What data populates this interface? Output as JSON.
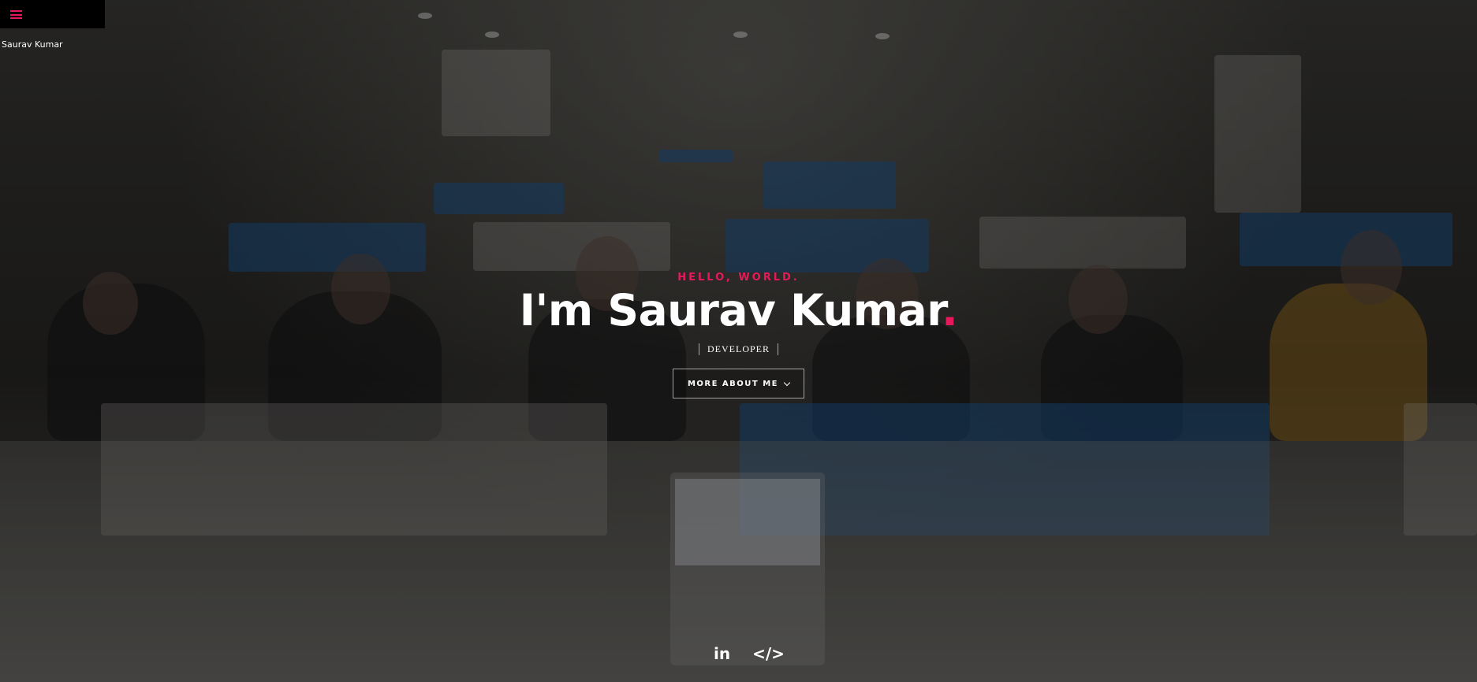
{
  "menu": {
    "hamburger_icon": "hamburger-menu-icon",
    "site_name": "Saurav Kumar"
  },
  "hero": {
    "greeting": "HELLO, WORLD.",
    "name": "I'm Saurav Kumar",
    "name_dot": ".",
    "role": "DEVELOPER",
    "more_button_label": "MORE ABOUT ME",
    "more_button_icon": "chevron-down-icon"
  },
  "social": {
    "linkedin_label": "in",
    "code_label": "</>"
  },
  "colors": {
    "accent": "#e7195e",
    "text": "#ffffff",
    "menu_bg": "#000000"
  }
}
